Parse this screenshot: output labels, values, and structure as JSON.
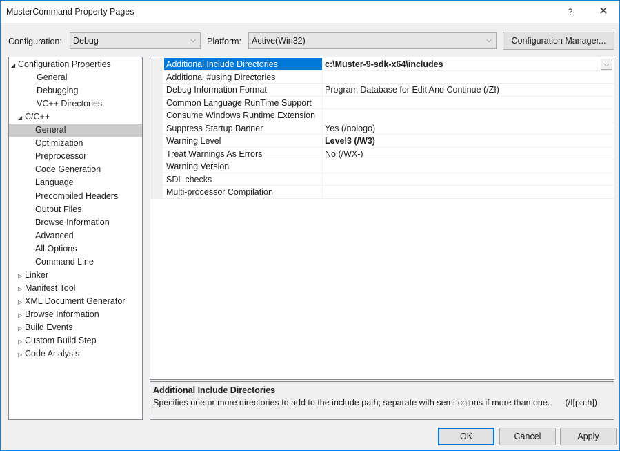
{
  "window": {
    "title": "MusterCommand Property Pages",
    "help_label": "?",
    "close_label": "✕"
  },
  "toolbar": {
    "configuration_label": "Configuration:",
    "configuration_value": "Debug",
    "platform_label": "Platform:",
    "platform_value": "Active(Win32)",
    "configuration_manager_label": "Configuration Manager...",
    "dropdown_arrow": "⌵"
  },
  "tree": {
    "items": [
      {
        "label": "Configuration Properties",
        "expander": "◢",
        "level": 0
      },
      {
        "label": "General",
        "expander": "",
        "level": 1
      },
      {
        "label": "Debugging",
        "expander": "",
        "level": 1
      },
      {
        "label": "VC++ Directories",
        "expander": "",
        "level": 1
      },
      {
        "label": "C/C++",
        "expander": "◢",
        "level": 1
      },
      {
        "label": "General",
        "expander": "",
        "level": 2,
        "selected": true
      },
      {
        "label": "Optimization",
        "expander": "",
        "level": 2
      },
      {
        "label": "Preprocessor",
        "expander": "",
        "level": 2
      },
      {
        "label": "Code Generation",
        "expander": "",
        "level": 2
      },
      {
        "label": "Language",
        "expander": "",
        "level": 2
      },
      {
        "label": "Precompiled Headers",
        "expander": "",
        "level": 2
      },
      {
        "label": "Output Files",
        "expander": "",
        "level": 2
      },
      {
        "label": "Browse Information",
        "expander": "",
        "level": 2
      },
      {
        "label": "Advanced",
        "expander": "",
        "level": 2
      },
      {
        "label": "All Options",
        "expander": "",
        "level": 2
      },
      {
        "label": "Command Line",
        "expander": "",
        "level": 2
      },
      {
        "label": "Linker",
        "expander": "▷",
        "level": 1
      },
      {
        "label": "Manifest Tool",
        "expander": "▷",
        "level": 1
      },
      {
        "label": "XML Document Generator",
        "expander": "▷",
        "level": 1
      },
      {
        "label": "Browse Information",
        "expander": "▷",
        "level": 1
      },
      {
        "label": "Build Events",
        "expander": "▷",
        "level": 1
      },
      {
        "label": "Custom Build Step",
        "expander": "▷",
        "level": 1
      },
      {
        "label": "Code Analysis",
        "expander": "▷",
        "level": 1
      }
    ]
  },
  "grid": {
    "rows": [
      {
        "name": "Additional Include Directories",
        "value": "c:\\Muster-9-sdk-x64\\includes",
        "bold": true,
        "selected": true
      },
      {
        "name": "Additional #using Directories",
        "value": "",
        "bold": false
      },
      {
        "name": "Debug Information Format",
        "value": "Program Database for Edit And Continue (/ZI)",
        "bold": false
      },
      {
        "name": "Common Language RunTime Support",
        "value": "",
        "bold": false
      },
      {
        "name": "Consume Windows Runtime Extension",
        "value": "",
        "bold": false
      },
      {
        "name": "Suppress Startup Banner",
        "value": "Yes (/nologo)",
        "bold": false
      },
      {
        "name": "Warning Level",
        "value": "Level3 (/W3)",
        "bold": true
      },
      {
        "name": "Treat Warnings As Errors",
        "value": "No (/WX-)",
        "bold": false
      },
      {
        "name": "Warning Version",
        "value": "",
        "bold": false
      },
      {
        "name": "SDL checks",
        "value": "",
        "bold": false
      },
      {
        "name": "Multi-processor Compilation",
        "value": "",
        "bold": false
      }
    ]
  },
  "description": {
    "title": "Additional Include Directories",
    "text": "Specifies one or more directories to add to the include path; separate with semi-colons if more than one.",
    "switch": "(/I[path])"
  },
  "buttons": {
    "ok": "OK",
    "cancel": "Cancel",
    "apply": "Apply"
  },
  "colors": {
    "selection": "#0078d7",
    "tree_selection": "#cccccc",
    "window_border": "#1883d7"
  }
}
